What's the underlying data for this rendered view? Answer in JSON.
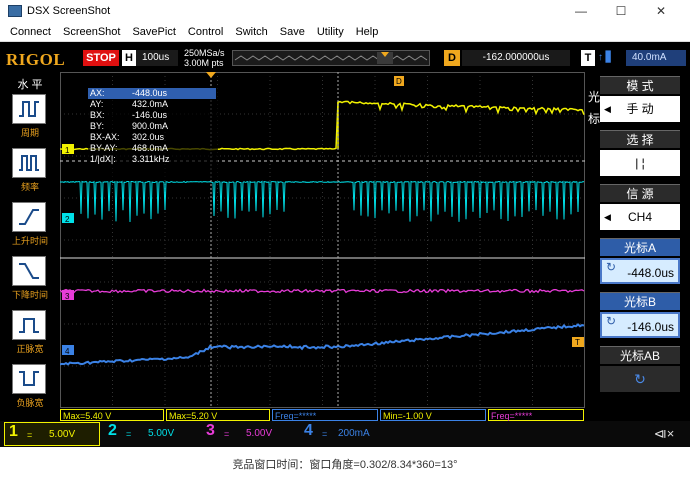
{
  "window": {
    "title": "DSX ScreenShot",
    "controls": {
      "min": "—",
      "max": "☐",
      "close": "✕"
    }
  },
  "menu": [
    "Connect",
    "ScreenShot",
    "SavePict",
    "Control",
    "Switch",
    "Save",
    "Utility",
    "Help"
  ],
  "top": {
    "brand": "RIGOL",
    "run_state": "STOP",
    "horiz_key": "H",
    "timebase": "100us",
    "sample_rate": "250MSa/s",
    "memory_depth": "3.00M pts",
    "delay_key": "D",
    "delay": "-162.000000us",
    "trig_key": "T",
    "trig_icons": "↑ ▋",
    "trig_level": "40.0mA"
  },
  "left_menu": {
    "header": "水 平",
    "items": [
      {
        "label": "周期",
        "icon": "period-icon"
      },
      {
        "label": "频率",
        "icon": "frequency-icon"
      },
      {
        "label": "上升时间",
        "icon": "rise-time-icon"
      },
      {
        "label": "下降时间",
        "icon": "fall-time-icon"
      },
      {
        "label": "正脉宽",
        "icon": "positive-width-icon"
      },
      {
        "label": "负脉宽",
        "icon": "negative-width-icon"
      }
    ]
  },
  "cursor_readout": [
    {
      "k": "AX:",
      "v": "-448.0us"
    },
    {
      "k": "AY:",
      "v": "432.0mA"
    },
    {
      "k": "BX:",
      "v": "-146.0us"
    },
    {
      "k": "BY:",
      "v": "900.0mA"
    },
    {
      "k": "BX-AX:",
      "v": "302.0us"
    },
    {
      "k": "BY-AY:",
      "v": "468.0mA"
    },
    {
      "k": "1/|dX|:",
      "v": "3.311kHz"
    }
  ],
  "right_menu": {
    "title": "光标",
    "mode_header": "模 式",
    "mode_value": "手 动",
    "select_header": "选 择",
    "select_value": "| ¦",
    "source_header": "信 源",
    "source_value": "CH4",
    "cursor_a_header": "光标A",
    "cursor_a_value": "-448.0us",
    "cursor_b_header": "光标B",
    "cursor_b_value": "-146.0us",
    "cursor_ab_header": "光标AB"
  },
  "status": {
    "max1": "Max=5.40 V",
    "max2": "Max=5.20 V",
    "freq1": "Freq=*****",
    "min": "Min=-1.00 V",
    "freq2": "Freq=*****"
  },
  "channels": [
    {
      "num": "1",
      "coupling": "=",
      "scale": "5.00V",
      "color": "#f2f200"
    },
    {
      "num": "2",
      "coupling": "=",
      "scale": "5.00V",
      "color": "#00e0e8"
    },
    {
      "num": "3",
      "coupling": "=",
      "scale": "5.00V",
      "color": "#e83cd8"
    },
    {
      "num": "4",
      "coupling": "=",
      "scale": "200mA",
      "color": "#3b82e6"
    }
  ],
  "channel_markers": [
    "1",
    "2",
    "3",
    "4"
  ],
  "trigger_marker": "T",
  "cursor_marker": "D",
  "speaker_label": "⧏×",
  "caption": "竞品窗口时间：窗口角度=0.302/8.34*360=13°",
  "colors": {
    "brand": "#f0a81e",
    "ch1": "#f2f200",
    "ch2": "#00e0e8",
    "ch3": "#e83cd8",
    "ch4": "#3b82e6"
  },
  "waveform_notes": {
    "ch1": "low level then step up at trigger with ripple, decaying",
    "ch2": "pulse train with gaps",
    "ch3": "noisy flat line",
    "ch4": "slow ramp rising"
  }
}
